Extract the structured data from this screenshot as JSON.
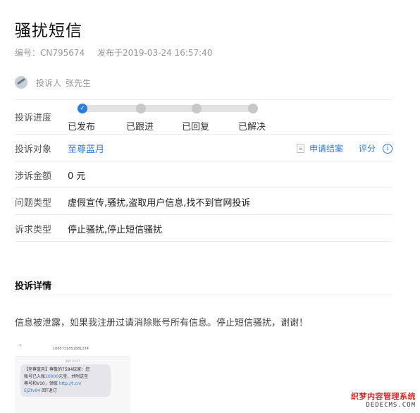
{
  "title": "骚扰短信",
  "meta": {
    "id": "编号：CN795674",
    "published": "发布于2019-03-24 16:57:40"
  },
  "complainant": {
    "label": "投诉人",
    "name": "张先生"
  },
  "progress": {
    "label": "投诉进度",
    "steps": [
      "已发布",
      "已跟进",
      "已回复",
      "已解决"
    ],
    "current_step": 1
  },
  "target": {
    "label": "投诉对象",
    "value": "至尊蓝月"
  },
  "actions": {
    "apply_close": "申请结案",
    "rate": "评分"
  },
  "amount": {
    "label": "涉诉金额",
    "value": "0 元"
  },
  "issue_type": {
    "label": "问题类型",
    "value": "虚假宣传,骚扰,盗取用户信息,找不到官网投诉"
  },
  "demand_type": {
    "label": "诉求类型",
    "value": "停止骚扰,停止短信骚扰"
  },
  "details": {
    "title": "投诉详情",
    "text": "信息被泄露，如果我注册过请消除账号所有信息。停止短信骚扰，谢谢！"
  },
  "sms_screenshot": {
    "sender": "1065731851881234",
    "time": "周四 10:47",
    "message_line1": "【至尊蓝月】尊敬的7584玩家：您",
    "message_line2a": "账号已入账",
    "message_amount": "10000",
    "message_line2b": "元宝，并附送至",
    "message_line3": "尊号和V10，领取",
    "message_link": "http://t.cn/",
    "message_code": "EJZtv94",
    "message_unsub": "回T退订"
  },
  "watermark": {
    "line1": "织梦内容管理系统",
    "line2": "DEDECMS.COM"
  },
  "colors": {
    "accent": "#2a7de1",
    "watermark_red": "#e62525",
    "divider": "#ececec"
  }
}
